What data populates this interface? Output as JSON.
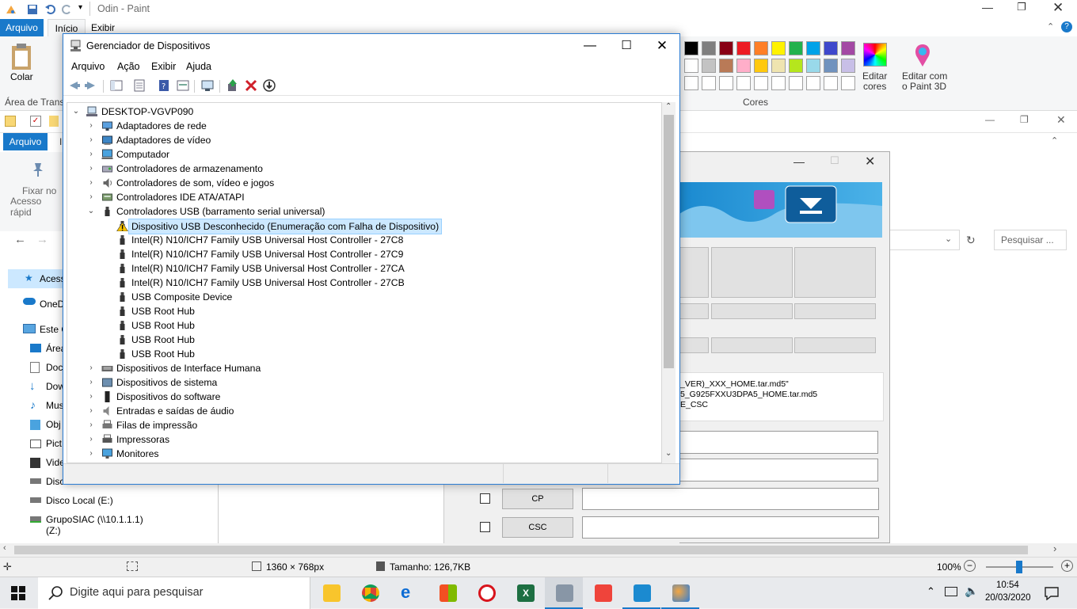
{
  "paint": {
    "title": "Odin - Paint",
    "tabs": {
      "file": "Arquivo",
      "home": "Início",
      "view": "Exibir"
    },
    "ribbon": {
      "paste": "Colar",
      "clipboard_group": "Área de Transf",
      "colors_group": "Cores",
      "edit_colors": "Editar\ncores",
      "edit_colors_l1": "Editar",
      "edit_colors_l2": "cores",
      "paint3d_l1": "Editar com",
      "paint3d_l2": "o Paint 3D"
    },
    "palette_row1": [
      "#000000",
      "#7f7f7f",
      "#880015",
      "#ed1c24",
      "#ff7f27",
      "#fff200",
      "#22b14c",
      "#00a2e8",
      "#3f48cc",
      "#a349a4"
    ],
    "palette_row2": [
      "#ffffff",
      "#c3c3c3",
      "#b97a57",
      "#ffaec9",
      "#ffc90e",
      "#efe4b0",
      "#b5e61d",
      "#99d9ea",
      "#7092be",
      "#c8bfe7"
    ],
    "status": {
      "dimensions": "1360 × 768px",
      "size": "Tamanho: 126,7KB",
      "zoom": "100%"
    }
  },
  "explorer": {
    "tab_file": "Arquivo",
    "pin_l1": "Fixar no",
    "pin_l2": "Acesso rápid",
    "search_placeholder": "Pesquisar ...",
    "nav": [
      "Acess",
      "OneD",
      "Este C",
      "Área",
      "Doc",
      "Dow",
      "Mus",
      "Obj",
      "Pict",
      "Vide",
      "Disco",
      "Disco Local (E:)",
      "GrupoSIAC (\\\\10.1.1.1) (Z:)"
    ]
  },
  "odin": {
    "file_l1": "_VER)_XXX_HOME.tar.md5\"",
    "file_l2": "5_G925FXXU3DPA5_HOME.tar.md5",
    "file_l3": "E_CSC",
    "cp_label": "CP",
    "csc_label": "CSC"
  },
  "devmgr": {
    "title": "Gerenciador de Dispositivos",
    "menu": [
      "Arquivo",
      "Ação",
      "Exibir",
      "Ajuda"
    ],
    "root": "DESKTOP-VGVP090",
    "categories_top": [
      "Adaptadores de rede",
      "Adaptadores de vídeo",
      "Computador",
      "Controladores de armazenamento",
      "Controladores de som, vídeo e jogos",
      "Controladores IDE ATA/ATAPI",
      "Controladores USB (barramento serial universal)"
    ],
    "usb_devices": [
      "Dispositivo USB Desconhecido (Enumeração com Falha de Dispositivo)",
      "Intel(R) N10/ICH7 Family USB Universal Host Controller - 27C8",
      "Intel(R) N10/ICH7 Family USB Universal Host Controller - 27C9",
      "Intel(R) N10/ICH7 Family USB Universal Host Controller - 27CA",
      "Intel(R) N10/ICH7 Family USB Universal Host Controller - 27CB",
      "USB Composite Device",
      "USB Root Hub",
      "USB Root Hub",
      "USB Root Hub",
      "USB Root Hub"
    ],
    "categories_bottom": [
      "Dispositivos de Interface Humana",
      "Dispositivos de sistema",
      "Dispositivos do software",
      "Entradas e saídas de áudio",
      "Filas de impressão",
      "Impressoras",
      "Monitores"
    ]
  },
  "taskbar": {
    "search_placeholder": "Digite aqui para pesquisar",
    "time": "10:54",
    "date": "20/03/2020"
  }
}
